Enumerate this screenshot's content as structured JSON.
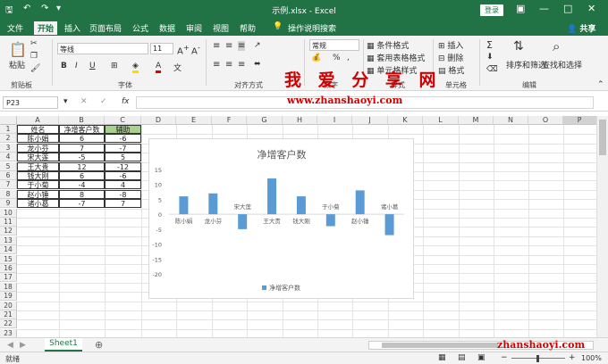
{
  "titlebar": {
    "title": "示例.xlsx  -  Excel",
    "login": "登录",
    "share": "共享"
  },
  "menu": [
    "文件",
    "开始",
    "插入",
    "页面布局",
    "公式",
    "数据",
    "审阅",
    "视图",
    "帮助",
    "操作说明搜索"
  ],
  "ribbon": {
    "clipboard_label": "剪贴板",
    "paste": "粘贴",
    "font_name": "等线",
    "font_size": "11",
    "font_label": "字体",
    "align_label": "对齐方式",
    "number_format": "常规",
    "number_label": "数字",
    "styles_label": "样式",
    "cond_format": "条件格式",
    "table_format": "套用表格格式",
    "cell_style": "单元格样式",
    "insert": "插入",
    "delete": "删除",
    "format": "格式",
    "cells_label": "单元格",
    "sort": "排序和筛选",
    "find": "查找和选择",
    "edit_label": "编辑"
  },
  "watermark": {
    "cn": "我 爱 分 享 网",
    "url": "www.zhanshaoyi.com",
    "url2": "zhanshaoyi.com"
  },
  "formula": {
    "namebox": "P23",
    "fx": "fx"
  },
  "columns": [
    "A",
    "B",
    "C",
    "D",
    "E",
    "F",
    "G",
    "H",
    "I",
    "J",
    "K",
    "L",
    "M",
    "N",
    "O",
    "P"
  ],
  "rows": [
    "1",
    "2",
    "3",
    "4",
    "5",
    "6",
    "7",
    "8",
    "9",
    "10",
    "11",
    "12",
    "13",
    "14",
    "15",
    "16",
    "17",
    "18",
    "19",
    "20",
    "21",
    "22",
    "23"
  ],
  "table": {
    "headers": [
      "姓名",
      "净增客户数",
      "辅助"
    ],
    "rows": [
      [
        "陈小娟",
        "6",
        "-6"
      ],
      [
        "龙小芬",
        "7",
        "-7"
      ],
      [
        "宋大莲",
        "-5",
        "5"
      ],
      [
        "王大贵",
        "12",
        "-12"
      ],
      [
        "钱大刚",
        "6",
        "-6"
      ],
      [
        "于小菊",
        "-4",
        "4"
      ],
      [
        "赵小锤",
        "8",
        "-8"
      ],
      [
        "诸小葛",
        "-7",
        "7"
      ]
    ]
  },
  "chart_data": {
    "type": "bar",
    "title": "净增客户数",
    "categories": [
      "陈小娟",
      "龙小芬",
      "宋大莲",
      "王大贵",
      "钱大刚",
      "于小菊",
      "赵小锤",
      "诸小葛"
    ],
    "series": [
      {
        "name": "净增客户数",
        "values": [
          6,
          7,
          -5,
          12,
          6,
          -4,
          8,
          -7
        ]
      }
    ],
    "ylim": [
      -20,
      15
    ],
    "yticks": [
      "15",
      "10",
      "5",
      "0",
      "-5",
      "-10",
      "-15",
      "-20"
    ],
    "legend": "bottom",
    "color": "#5b9bd5"
  },
  "sheets": {
    "active": "Sheet1"
  },
  "status": {
    "ready": "就绪",
    "zoom": "100%"
  }
}
